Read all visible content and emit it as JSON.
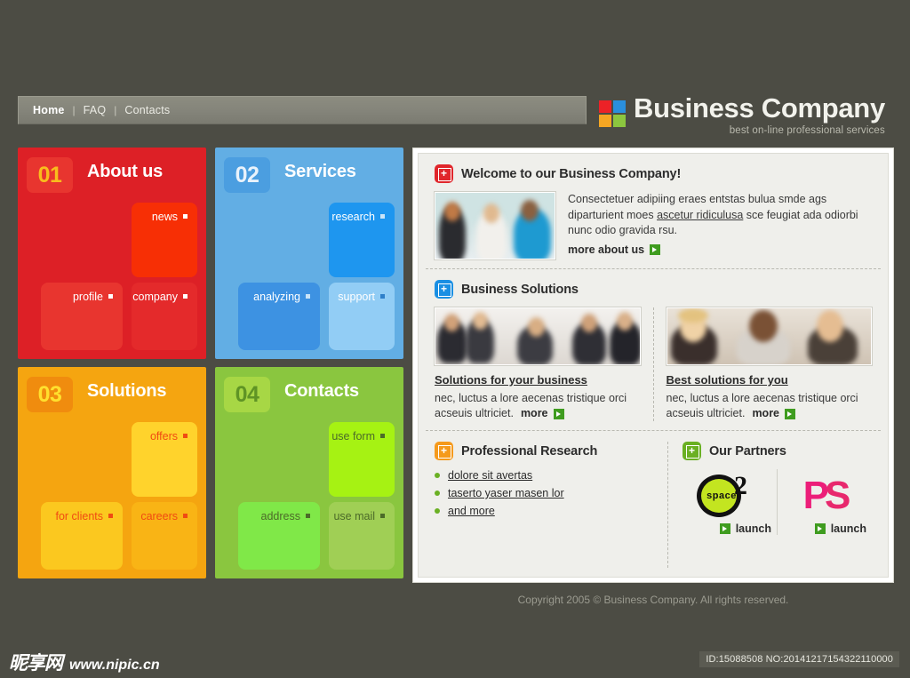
{
  "nav": {
    "items": [
      {
        "label": "Home",
        "active": true
      },
      {
        "label": "FAQ",
        "active": false
      },
      {
        "label": "Contacts",
        "active": false
      }
    ],
    "separator": "|"
  },
  "logo": {
    "title": "Business Company",
    "tagline": "best on-line professional services",
    "squares": [
      "#ec2227",
      "#2a8fdc",
      "#f5a623",
      "#8cc63f"
    ]
  },
  "blocks": [
    {
      "number": "01",
      "title": "About us",
      "accent": "#dd2026",
      "tiles": [
        {
          "label": "news"
        },
        {
          "label": "profile"
        },
        {
          "label": "company"
        }
      ]
    },
    {
      "number": "02",
      "title": "Services",
      "accent": "#62aee4",
      "tiles": [
        {
          "label": "research"
        },
        {
          "label": "analyzing"
        },
        {
          "label": "support"
        }
      ]
    },
    {
      "number": "03",
      "title": "Solutions",
      "accent": "#f5a510",
      "tiles": [
        {
          "label": "offers"
        },
        {
          "label": "for clients"
        },
        {
          "label": "careers"
        }
      ]
    },
    {
      "number": "04",
      "title": "Contacts",
      "accent": "#8ac63f",
      "tiles": [
        {
          "label": "use form"
        },
        {
          "label": "address"
        },
        {
          "label": "use mail"
        }
      ]
    }
  ],
  "panel": {
    "welcome": {
      "icon_color": "#e0262b",
      "title": "Welcome to our Business Company!",
      "text_before": "Consectetuer adipiing eraes entstas bulua smde ags diparturient moes ",
      "text_link": "ascetur ridiculusa",
      "text_after": " sce feugiat ada odiorbi nunc odio gravida rsu.",
      "more_label": "more about us"
    },
    "solutions": {
      "icon_color": "#1a8fe3",
      "title": "Business Solutions",
      "cards": [
        {
          "heading": "Solutions for your business",
          "text": "nec, luctus a lore aecenas tristique orci acseuis ultriciet.",
          "more_label": "more"
        },
        {
          "heading": "Best solutions for you",
          "text": "nec, luctus a lore aecenas tristique orci acseuis ultriciet.",
          "more_label": "more"
        }
      ]
    },
    "research": {
      "icon_color": "#f59a1c",
      "title": "Professional Research",
      "links": [
        "dolore sit avertas",
        "taserto yaser masen lor",
        "and more"
      ]
    },
    "partners": {
      "icon_color": "#6ab023",
      "title": "Our Partners",
      "items": [
        {
          "name": "space2",
          "word": "space",
          "mark": "2",
          "launch_label": "launch"
        },
        {
          "name": "PS",
          "word": "P",
          "mark": "S",
          "launch_label": "launch"
        }
      ]
    }
  },
  "footer": {
    "copyright": "Copyright 2005 © Business Company. All rights reserved."
  },
  "watermark": {
    "site_cn": "昵享网",
    "site_url": "www.nipic.cn",
    "id_text": "ID:15088508 NO:20141217154322110000"
  }
}
